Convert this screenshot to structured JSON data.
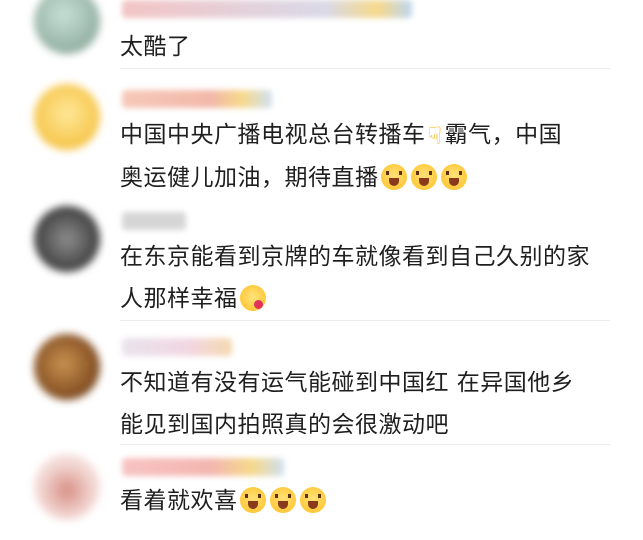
{
  "comments": [
    {
      "text": "太酷了",
      "avatar_colors": [
        "#c7e0d5",
        "#7e9b8d"
      ],
      "name_colors": [
        "#f3c4c4",
        "#d9d9e8"
      ]
    },
    {
      "text": "中国中央广播电视总台转播车",
      "text_after": "霸气，中国",
      "text_line2": "奥运健儿加油，期待直播",
      "avatar_colors": [
        "#ffe89a",
        "#f6c54a"
      ],
      "name_colors": [
        "#f6c9b9",
        "#cfe0f2"
      ]
    },
    {
      "text": "在东京能看到京牌的车就像看到自己久别的家",
      "text_line2": "人那样幸福",
      "avatar_colors": [
        "#8d8d8d",
        "#3a3a3a"
      ],
      "name_colors": [
        "#d6d6d6",
        "#d6d6d6"
      ]
    },
    {
      "text": "不知道有没有运气能碰到中国红 在异国他乡",
      "text_line2": "能见到国内拍照真的会很激动吧",
      "avatar_colors": [
        "#b0773a",
        "#5a3316"
      ],
      "name_colors": [
        "#e9e3ec",
        "#f5d9b0"
      ]
    },
    {
      "text": "看着就欢喜",
      "avatar_colors": [
        "#f3d8d4",
        "#c98a80"
      ],
      "name_colors": [
        "#f7c3c3",
        "#cfdff0"
      ]
    }
  ],
  "icons": {
    "hand": "point-down-icon",
    "face": "grinning-tears-icon",
    "blush": "blush-heart-icon"
  }
}
